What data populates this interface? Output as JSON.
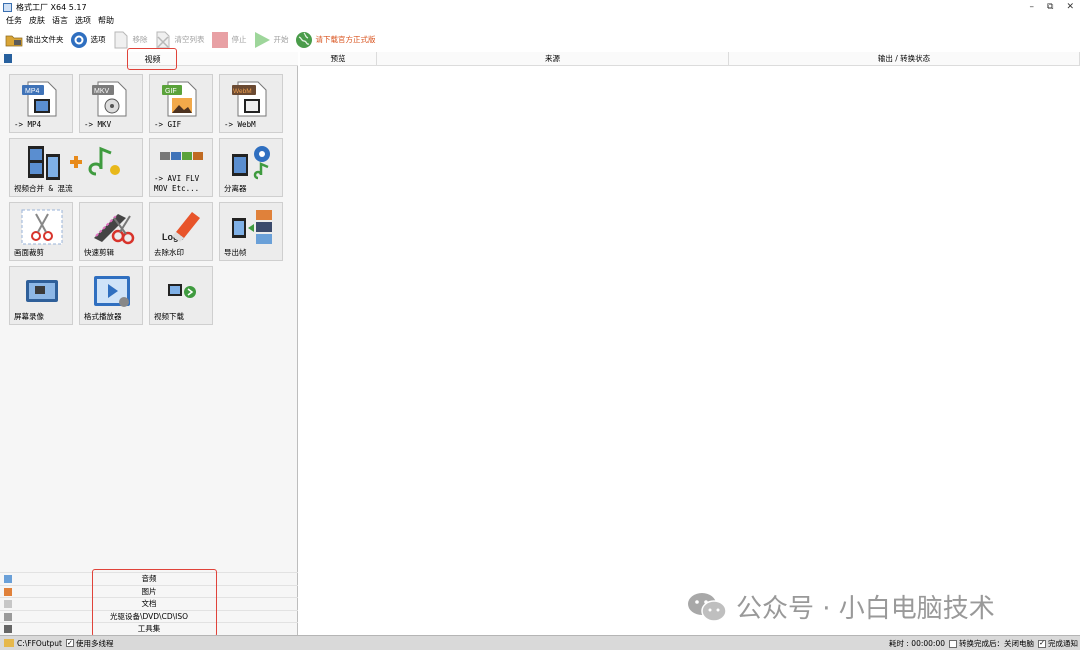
{
  "window": {
    "title": "格式工厂 X64 5.17",
    "controls": [
      "–",
      "⧉",
      "✕"
    ]
  },
  "menu": [
    "任务",
    "皮肤",
    "语言",
    "选项",
    "帮助"
  ],
  "toolbar": {
    "output_folder": "输出文件夹",
    "options": "选项",
    "remove": "移除",
    "clear_list": "清空列表",
    "stop": "停止",
    "start": "开始",
    "promo": "请下载官方正式版"
  },
  "left": {
    "current_category": "视频",
    "tiles": [
      {
        "label": "-> MP4",
        "badge": "MP4",
        "badge_color": "#3f73b8"
      },
      {
        "label": "-> MKV",
        "badge": "MKV",
        "badge_color": "#8a8a8a"
      },
      {
        "label": "-> GIF",
        "badge": "GIF",
        "badge_color": "#5aa23a"
      },
      {
        "label": "-> WebM",
        "badge": "WebM",
        "badge_color": "#c06a22"
      },
      {
        "label": "视频合并 & 混流"
      },
      {
        "label": "-> AVI FLV\nMOV Etc..."
      },
      {
        "label": "分离器"
      },
      {
        "label": "画面裁剪"
      },
      {
        "label": "快速剪辑"
      },
      {
        "label": "去除水印",
        "logo_text": "Logo"
      },
      {
        "label": "导出帧"
      },
      {
        "label": "屏幕录像"
      },
      {
        "label": "格式播放器"
      },
      {
        "label": "视频下载"
      }
    ],
    "categories": [
      "音频",
      "图片",
      "文档",
      "光驱设备\\DVD\\CD\\ISO",
      "工具集"
    ]
  },
  "right": {
    "columns": [
      "预览",
      "来源",
      "输出 / 转换状态"
    ]
  },
  "watermark": "公众号 · 小白电脑技术",
  "status": {
    "output_path": "C:\\FFOutput",
    "multithread": "使用多线程",
    "elapsed": "耗时 : 00:00:00",
    "after_convert": "转换完成后：关闭电脑",
    "notify": "完成通知"
  },
  "colors": {
    "accent_red": "#e0433a",
    "promo": "#d9531e"
  }
}
